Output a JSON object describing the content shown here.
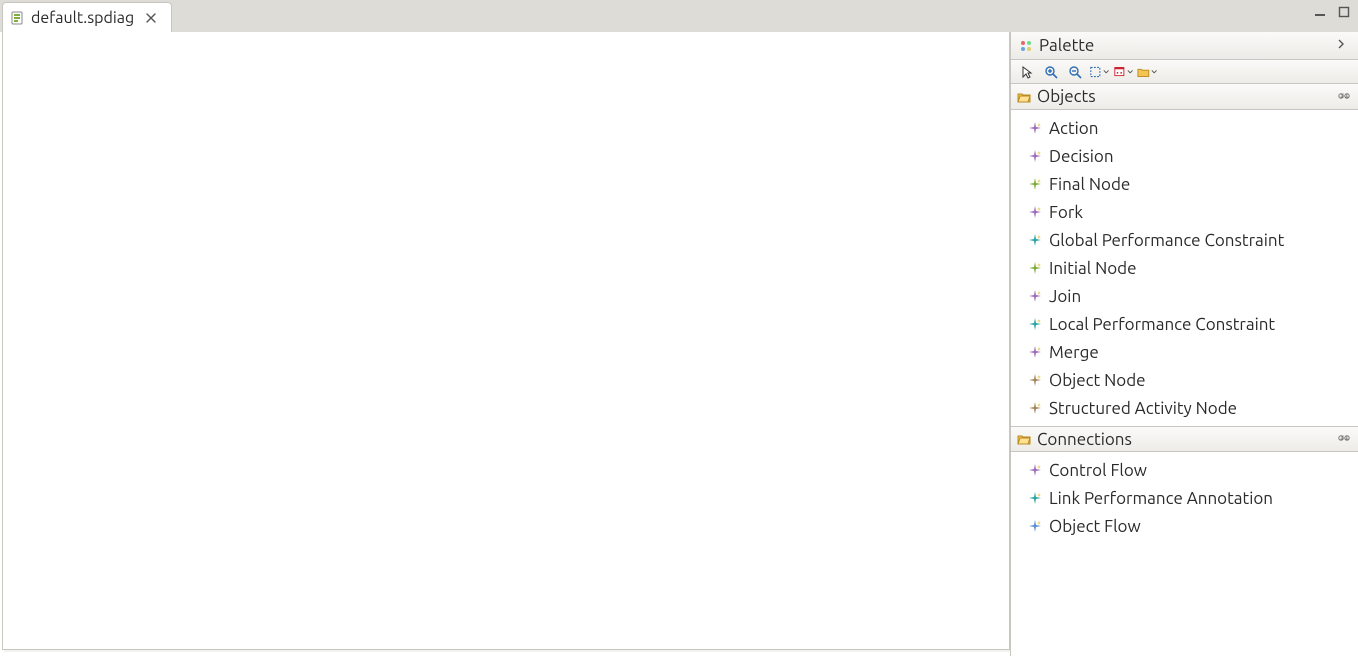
{
  "tab": {
    "label": "default.spdiag"
  },
  "palette": {
    "title": "Palette",
    "toolbar": {
      "tools": [
        {
          "name": "select-tool-icon",
          "type": "select"
        },
        {
          "name": "zoom-in-icon",
          "type": "zoom-in"
        },
        {
          "name": "zoom-out-icon",
          "type": "zoom-out"
        },
        {
          "name": "marquee-tool-icon",
          "type": "marquee",
          "dropdown": true
        },
        {
          "name": "note-tool-icon",
          "type": "note",
          "dropdown": true
        },
        {
          "name": "folder-tool-icon",
          "type": "folder",
          "dropdown": true
        }
      ]
    },
    "sections": [
      {
        "name": "objects",
        "label": "Objects",
        "items": [
          {
            "label": "Action",
            "color": "#a06bb8"
          },
          {
            "label": "Decision",
            "color": "#a06bb8"
          },
          {
            "label": "Final Node",
            "color": "#7fae3a"
          },
          {
            "label": "Fork",
            "color": "#a06bb8"
          },
          {
            "label": "Global Performance Constraint",
            "color": "#2aa4a4"
          },
          {
            "label": "Initial Node",
            "color": "#7fae3a"
          },
          {
            "label": "Join",
            "color": "#a06bb8"
          },
          {
            "label": "Local Performance Constraint",
            "color": "#2aa4a4"
          },
          {
            "label": "Merge",
            "color": "#a06bb8"
          },
          {
            "label": "Object Node",
            "color": "#a7865f"
          },
          {
            "label": "Structured Activity Node",
            "color": "#a7865f"
          }
        ]
      },
      {
        "name": "connections",
        "label": "Connections",
        "items": [
          {
            "label": "Control Flow",
            "color": "#a06bb8"
          },
          {
            "label": "Link Performance Annotation",
            "color": "#2aa4a4"
          },
          {
            "label": "Object Flow",
            "color": "#5a8fd6"
          }
        ]
      }
    ]
  }
}
